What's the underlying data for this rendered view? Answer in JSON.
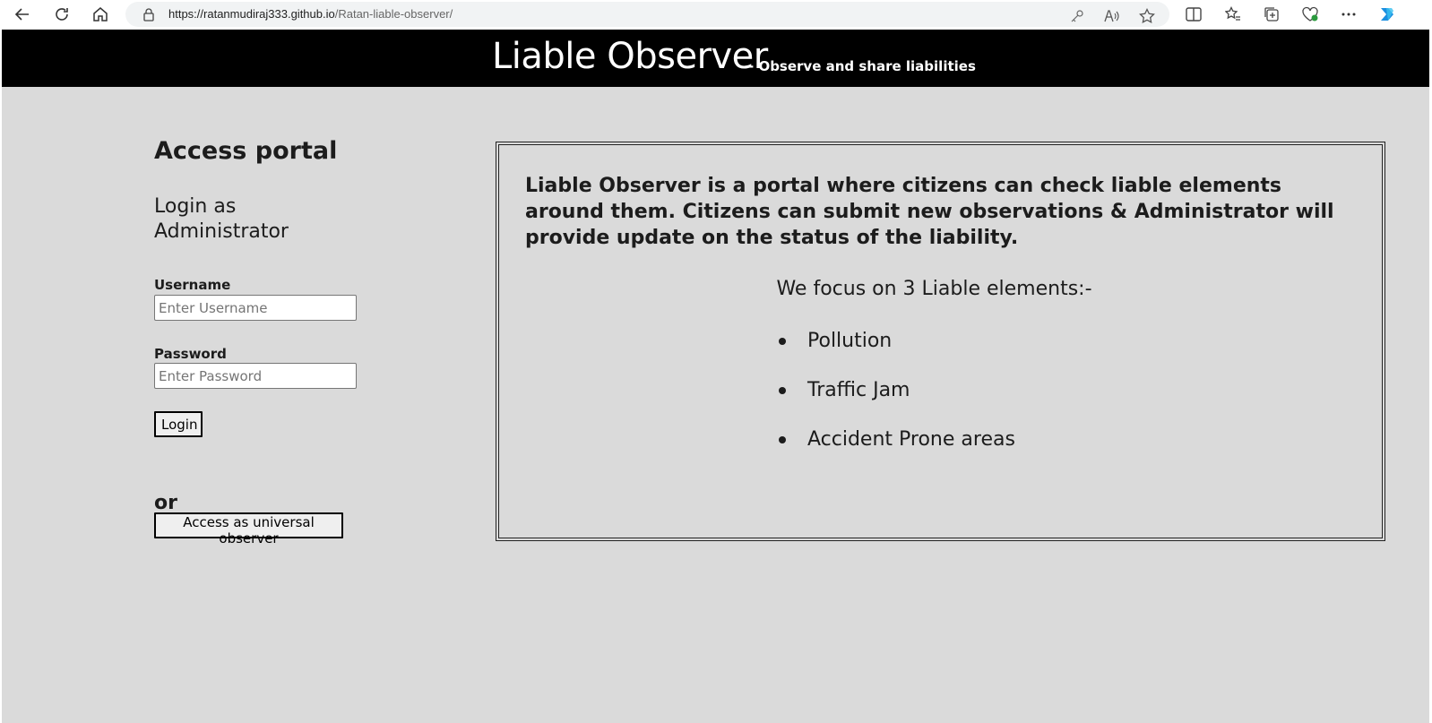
{
  "browser": {
    "url_host": "https://ratanmudiraj333.github.io",
    "url_path": "/Ratan-liable-observer/"
  },
  "header": {
    "title": "Liable Observer",
    "subtitle": "- Observe and share liabilities"
  },
  "access": {
    "title": "Access portal",
    "login_title": "Login as Administrator",
    "username_label": "Username",
    "username_placeholder": "Enter Username",
    "password_label": "Password",
    "password_placeholder": "Enter Password",
    "login_button": "Login",
    "or_text": "or",
    "observer_button": "Access as universal observer"
  },
  "info": {
    "description": "Liable Observer is a portal where citizens can check liable elements around them. Citizens can submit new observations & Administrator will provide update on the status of the liability.",
    "focus_heading": "We focus on 3 Liable elements:-",
    "elements": [
      "Pollution",
      "Traffic Jam",
      "Accident Prone areas"
    ]
  }
}
